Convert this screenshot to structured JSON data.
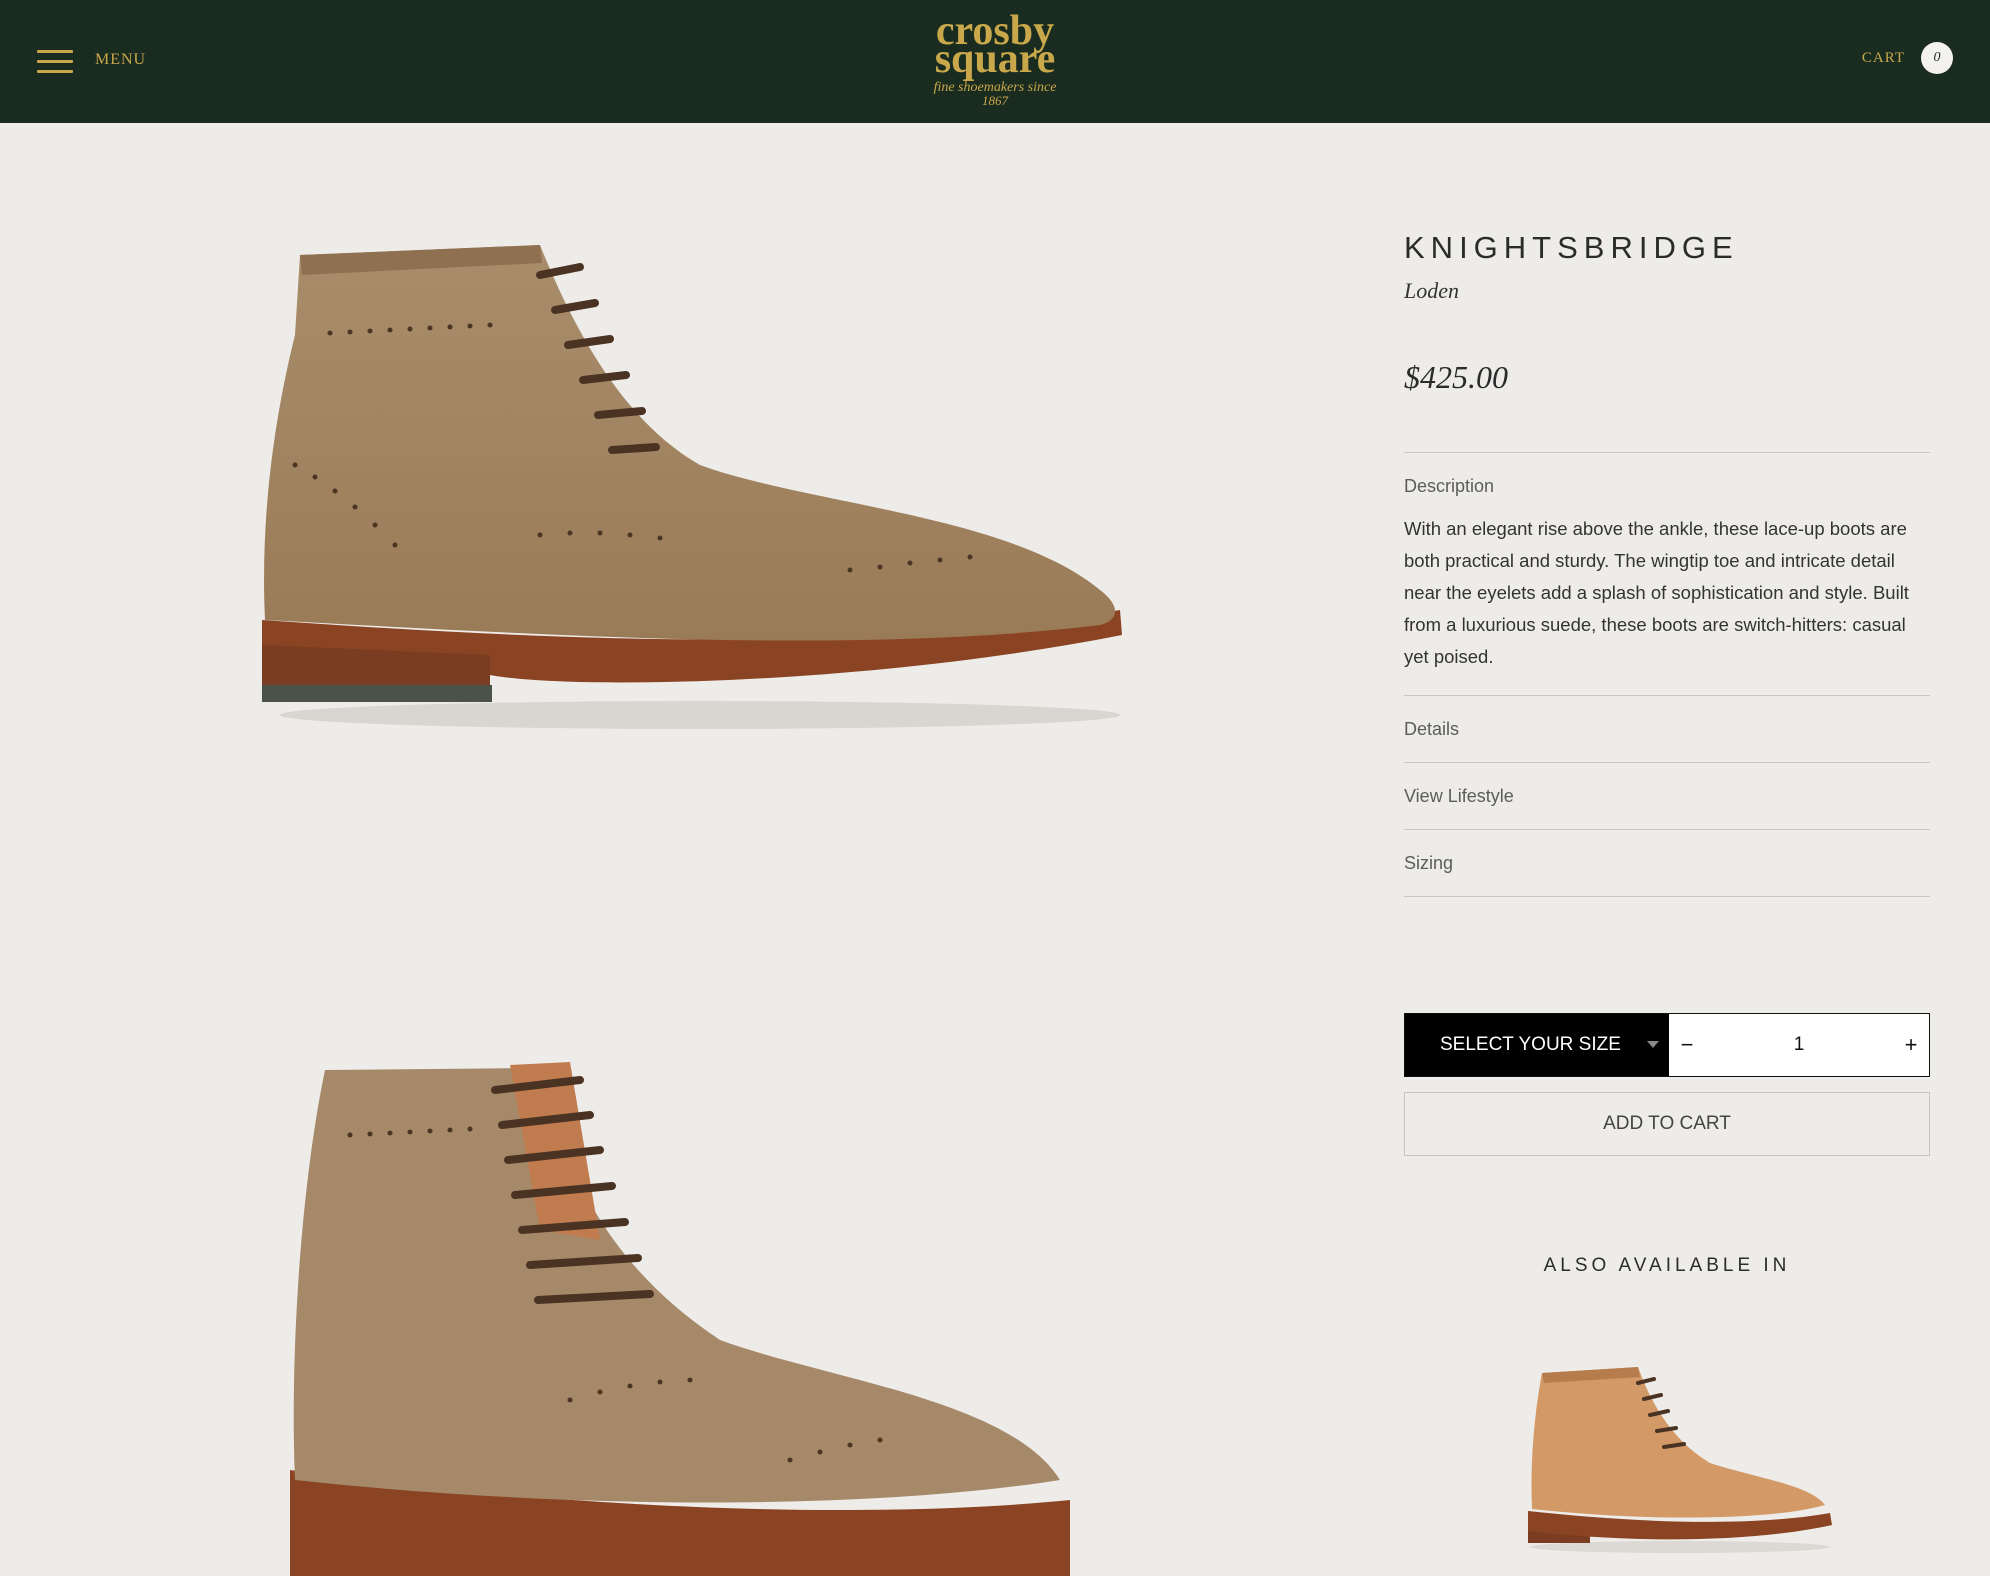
{
  "header": {
    "menu_label": "MENU",
    "logo": {
      "line1": "crosby",
      "line2": "square",
      "tagline": "fine shoemakers since",
      "year": "1867"
    },
    "cart_label": "CART",
    "cart_count": "0"
  },
  "product": {
    "name": "KNIGHTSBRIDGE",
    "color": "Loden",
    "price": "$425.00",
    "sections": {
      "description": {
        "label": "Description",
        "text": "With an elegant rise above the ankle, these lace-up boots are both practical and sturdy. The wingtip toe and intricate detail near the eyelets add a splash of sophistication and style. Built from a luxurious suede, these boots are switch-hitters: casual yet poised."
      },
      "details": {
        "label": "Details"
      },
      "lifestyle": {
        "label": "View Lifestyle"
      },
      "sizing": {
        "label": "Sizing"
      }
    }
  },
  "purchase": {
    "size_select_label": "SELECT YOUR SIZE",
    "qty_minus": "−",
    "qty_plus": "+",
    "quantity": "1",
    "add_to_cart_label": "ADD TO CART"
  },
  "also_available": {
    "title": "ALSO AVAILABLE IN"
  },
  "colors": {
    "header_bg": "#1a2b1f",
    "brand_gold": "#c8a84b",
    "page_bg": "#eeece9",
    "suede": "#a88a66",
    "sole": "#7a3d22"
  }
}
